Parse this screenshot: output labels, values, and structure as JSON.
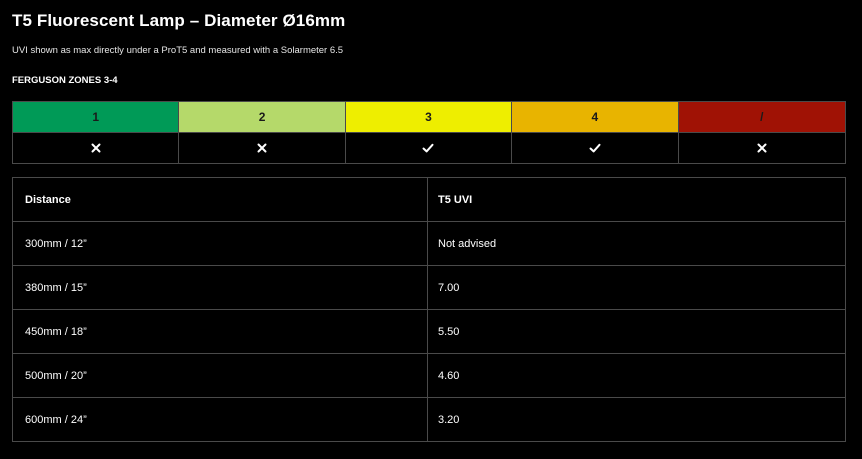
{
  "title": "T5 Fluorescent Lamp – Diameter Ø16mm",
  "subtitle": "UVI shown as max directly under a ProT5 and measured with a Solarmeter 6.5",
  "zones_heading": "FERGUSON ZONES 3-4",
  "zones": [
    {
      "label": "1",
      "color": "#009a57",
      "mark": "cross"
    },
    {
      "label": "2",
      "color": "#b5d96a",
      "mark": "cross"
    },
    {
      "label": "3",
      "color": "#eeee00",
      "mark": "check"
    },
    {
      "label": "4",
      "color": "#e8b400",
      "mark": "check"
    },
    {
      "label": "/",
      "color": "#a01205",
      "mark": "cross"
    }
  ],
  "table": {
    "headers": [
      "Distance",
      "T5 UVI"
    ],
    "rows": [
      [
        "300mm / 12”",
        "Not advised"
      ],
      [
        "380mm / 15”",
        "7.00"
      ],
      [
        "450mm / 18”",
        "5.50"
      ],
      [
        "500mm / 20”",
        "4.60"
      ],
      [
        "600mm / 24”",
        "3.20"
      ]
    ]
  }
}
